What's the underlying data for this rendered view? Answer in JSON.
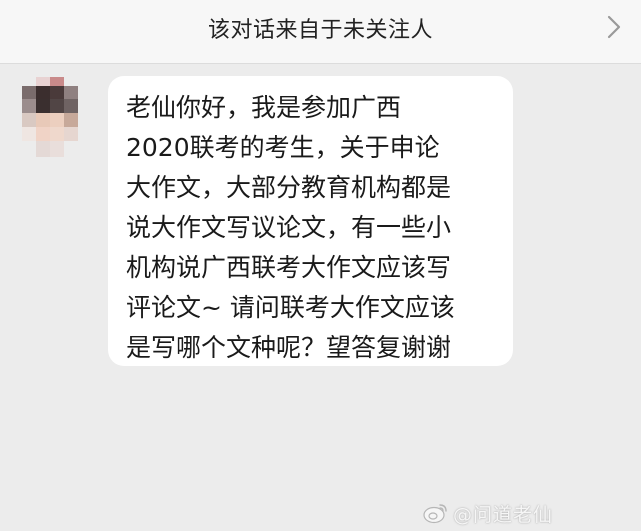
{
  "conversation": {
    "banner": "该对话来自于未关注人",
    "message_lines": [
      "老仙你好，我是参加广西",
      "2020联考的考生，关于申论",
      "大作文，大部分教育机构都是",
      "说大作文写议论文，有一些小",
      "机构说广西联考大作文应该写",
      "评论文~ 请问联考大作文应该",
      "是写哪个文种呢？望答复谢谢"
    ]
  },
  "watermark": {
    "text": "@问道老仙"
  },
  "colors": {
    "background": "#ececec",
    "header": "#f7f7f7",
    "bubble": "#ffffff",
    "text": "#1a1a1a"
  },
  "icons": [
    "chevron-right-icon",
    "weibo-logo-icon"
  ]
}
